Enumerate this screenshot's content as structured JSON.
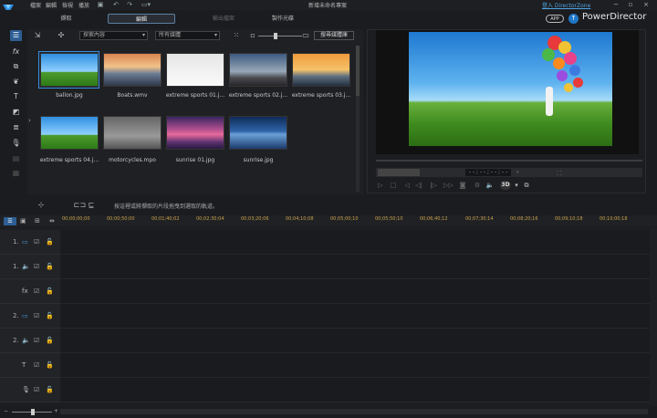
{
  "titlebar": {
    "menus": [
      "檔案",
      "編輯",
      "檢視",
      "播放"
    ],
    "doc_title": "新增未命名專案",
    "link": "登入 DirectorZone"
  },
  "modes": {
    "capture": "擷取",
    "edit": "編輯",
    "produce": "輸出檔案",
    "disc": "製作光碟"
  },
  "brand": {
    "app_badge": "APP",
    "name": "PowerDirector"
  },
  "library": {
    "filter_dropdown": "探索內容",
    "type_dropdown": "所有媒體",
    "search_button": "搜尋媒體庫",
    "items": [
      {
        "name": "ballon.jpg"
      },
      {
        "name": "Boats.wmv"
      },
      {
        "name": "extreme sports 01.j..."
      },
      {
        "name": "extreme sports 02.j..."
      },
      {
        "name": "extreme sports 03.j..."
      },
      {
        "name": "extreme sports 04.j..."
      },
      {
        "name": "motorcycles.mpo"
      },
      {
        "name": "sunrise 01.jpg"
      },
      {
        "name": "sunrise.jpg"
      }
    ]
  },
  "preview": {
    "timecode": "- - ; - - ; - - ; - -",
    "mode_dropdown": "",
    "btn_3d": "3D"
  },
  "timeline": {
    "hint": "按這裡或將擷取的片段拖曳到選取的軌道。",
    "ticks": [
      "00;00;00;00",
      "00;00;50;00",
      "00;01;40;02",
      "00;02;30;04",
      "00;03;20;06",
      "00;04;10;08",
      "00;05;00;10",
      "00;05;50;10",
      "00;06;40;12",
      "00;07;30;14",
      "00;08;20;16",
      "00;09;10;18",
      "00;10;00;18"
    ],
    "tracks": [
      {
        "label": "1.",
        "icon": "video"
      },
      {
        "label": "1.",
        "icon": "audio"
      },
      {
        "label": "",
        "icon": "fx"
      },
      {
        "label": "2.",
        "icon": "video"
      },
      {
        "label": "2.",
        "icon": "audio"
      },
      {
        "label": "",
        "icon": "title"
      },
      {
        "label": "",
        "icon": "voice"
      }
    ]
  }
}
